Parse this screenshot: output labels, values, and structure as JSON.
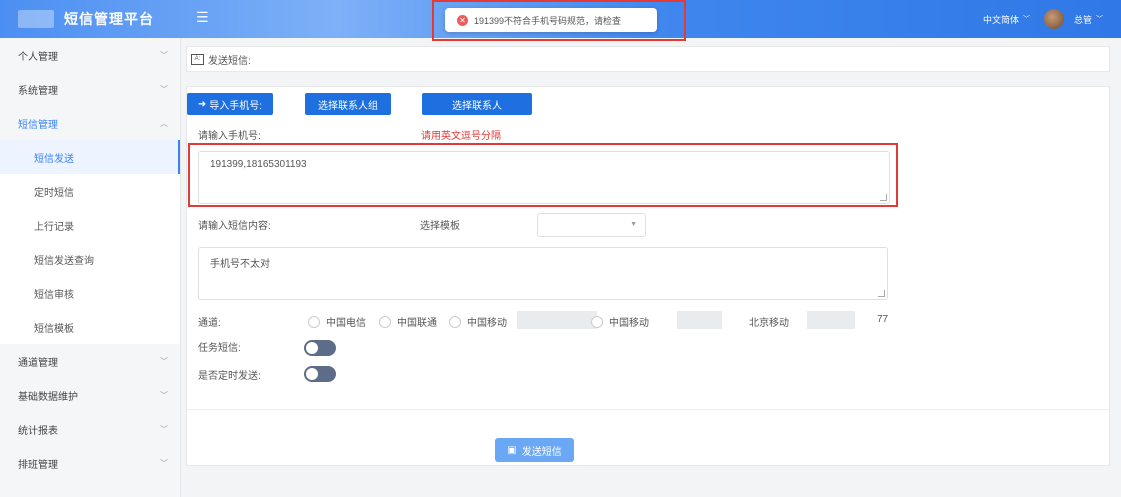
{
  "header": {
    "app_title": "短信管理平台",
    "language": "中文简体",
    "user": "总管",
    "toast_message": "191399不符合手机号码规范，请检查",
    "colors": {
      "brand": "#3f86ee",
      "error": "#e53935"
    }
  },
  "sidebar": {
    "groups": [
      {
        "label": "个人管理"
      },
      {
        "label": "系统管理"
      },
      {
        "label": "短信管理"
      },
      {
        "label": "通道管理"
      },
      {
        "label": "基础数据维护"
      },
      {
        "label": "统计报表"
      },
      {
        "label": "排班管理"
      }
    ],
    "sub_items": [
      {
        "label": "短信发送"
      },
      {
        "label": "定时短信"
      },
      {
        "label": "上行记录"
      },
      {
        "label": "短信发送查询"
      },
      {
        "label": "短信审核"
      },
      {
        "label": "短信模板"
      }
    ]
  },
  "page": {
    "title": "发送短信:"
  },
  "form": {
    "buttons": {
      "import": "导入手机号:",
      "select_group": "选择联系人组",
      "select_contact": "选择联系人"
    },
    "phone_label": "请输入手机号:",
    "phone_hint": "请用英文逗号分隔",
    "phone_value": "191399,18165301193",
    "content_label": "请输入短信内容:",
    "template_label": "选择模板",
    "content_value": "手机号不太对",
    "channel_label": "通道:",
    "channels": [
      {
        "label": "中国电信"
      },
      {
        "label": "中国联通"
      },
      {
        "label": "中国移动"
      },
      {
        "label": "中国移动"
      },
      {
        "label": "北京移动"
      }
    ],
    "channel_extra": "77",
    "task_label": "任务短信:",
    "timed_label": "是否定时发送:",
    "send_button": "发送短信"
  }
}
